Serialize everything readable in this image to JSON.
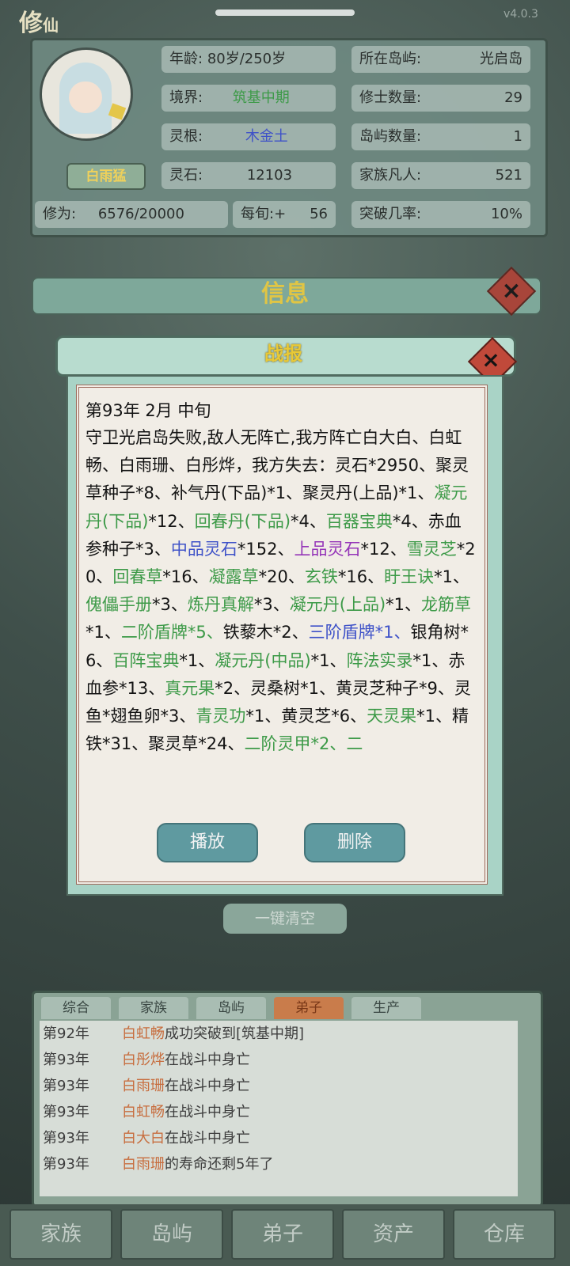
{
  "app": {
    "title_main": "修",
    "title_sub": "仙",
    "version": "v4.0.3"
  },
  "character": {
    "name": "白雨猛",
    "stats_left": [
      {
        "label": "年龄:",
        "value": "80岁/250岁",
        "color": "#2a2f2d"
      },
      {
        "label": "境界:",
        "value": "筑基中期",
        "color": "#3d9a48"
      },
      {
        "label": "灵根:",
        "value": "木金土",
        "color": "#3f52c8"
      },
      {
        "label": "灵石:",
        "value": "12103",
        "color": "#2a2f2d"
      }
    ],
    "stats_right": [
      {
        "label": "所在岛屿:",
        "value": "光启岛"
      },
      {
        "label": "修士数量:",
        "value": "29"
      },
      {
        "label": "岛屿数量:",
        "value": "1"
      },
      {
        "label": "家族凡人:",
        "value": "521"
      }
    ],
    "cultivation": {
      "label": "修为:",
      "value": "6576/20000",
      "per_label": "每旬:+",
      "per_value": "56",
      "break_label": "突破几率:",
      "break_value": "10%"
    }
  },
  "info_panel": {
    "title": "信息",
    "clear_label": "一键清空"
  },
  "report": {
    "title": "战报",
    "date": "第93年  2月  中旬",
    "intro": "守卫光启岛失败,敌人无阵亡,我方阵亡白大白、白虹畅、白雨珊、白彤烨，我方失去：",
    "items": [
      {
        "t": "灵石*2950、",
        "c": "black"
      },
      {
        "t": "聚灵草种子*8、",
        "c": "black"
      },
      {
        "t": "补气丹(下品)*1、",
        "c": "black"
      },
      {
        "t": "聚灵丹(上品)*1、",
        "c": "black"
      },
      {
        "t": "凝元丹(下品)",
        "c": "green"
      },
      {
        "t": "*12、",
        "c": "black"
      },
      {
        "t": "回春丹(下品)",
        "c": "green"
      },
      {
        "t": "*4、",
        "c": "black"
      },
      {
        "t": "百器宝典",
        "c": "green"
      },
      {
        "t": "*4、",
        "c": "black"
      },
      {
        "t": "赤血参种子*3、",
        "c": "black"
      },
      {
        "t": "中品灵石",
        "c": "blue"
      },
      {
        "t": "*152、",
        "c": "black"
      },
      {
        "t": "上品灵石",
        "c": "purple"
      },
      {
        "t": "*12、",
        "c": "black"
      },
      {
        "t": "雪灵芝",
        "c": "green"
      },
      {
        "t": "*20、",
        "c": "black"
      },
      {
        "t": "回春草",
        "c": "green"
      },
      {
        "t": "*16、",
        "c": "black"
      },
      {
        "t": "凝露草",
        "c": "green"
      },
      {
        "t": "*20、",
        "c": "black"
      },
      {
        "t": "玄铁",
        "c": "green"
      },
      {
        "t": "*16、",
        "c": "black"
      },
      {
        "t": "盱王诀",
        "c": "green"
      },
      {
        "t": "*1、",
        "c": "black"
      },
      {
        "t": "傀儡手册",
        "c": "green"
      },
      {
        "t": "*3、",
        "c": "black"
      },
      {
        "t": "炼丹真解",
        "c": "green"
      },
      {
        "t": "*3、",
        "c": "black"
      },
      {
        "t": "凝元丹(上品)",
        "c": "green"
      },
      {
        "t": "*1、",
        "c": "black"
      },
      {
        "t": "龙筋草",
        "c": "green"
      },
      {
        "t": "*1、",
        "c": "black"
      },
      {
        "t": "二阶盾牌*5、",
        "c": "green"
      },
      {
        "t": "铁藜木*2、",
        "c": "black"
      },
      {
        "t": "三阶盾牌*1、",
        "c": "blue"
      },
      {
        "t": "银角树*6、",
        "c": "black"
      },
      {
        "t": "百阵宝典",
        "c": "green"
      },
      {
        "t": "*1、",
        "c": "black"
      },
      {
        "t": "凝元丹(中品)",
        "c": "green"
      },
      {
        "t": "*1、",
        "c": "black"
      },
      {
        "t": "阵法实录",
        "c": "green"
      },
      {
        "t": "*1、",
        "c": "black"
      },
      {
        "t": "赤血参*13、",
        "c": "black"
      },
      {
        "t": "真元果",
        "c": "green"
      },
      {
        "t": "*2、",
        "c": "black"
      },
      {
        "t": "灵桑树*1、",
        "c": "black"
      },
      {
        "t": "黄灵芝种子*9、",
        "c": "black"
      },
      {
        "t": "灵鱼*翅鱼卵*3、",
        "c": "black"
      },
      {
        "t": "青灵功",
        "c": "green"
      },
      {
        "t": "*1、",
        "c": "black"
      },
      {
        "t": "黄灵芝*6、",
        "c": "black"
      },
      {
        "t": "天灵果",
        "c": "green"
      },
      {
        "t": "*1、",
        "c": "black"
      },
      {
        "t": "精铁*31、",
        "c": "black"
      },
      {
        "t": "聚灵草*24、",
        "c": "black"
      },
      {
        "t": "二阶灵甲*2、二",
        "c": "green"
      }
    ],
    "play_label": "播放",
    "delete_label": "删除"
  },
  "log": {
    "tabs": [
      "综合",
      "家族",
      "岛屿",
      "弟子",
      "生产"
    ],
    "active_tab": 3,
    "rows": [
      {
        "year": "第92年",
        "name": "白虹畅",
        "text": "成功突破到[筑基中期]"
      },
      {
        "year": "第93年",
        "name": "白彤烨",
        "text": "在战斗中身亡"
      },
      {
        "year": "第93年",
        "name": "白雨珊",
        "text": "在战斗中身亡"
      },
      {
        "year": "第93年",
        "name": "白虹畅",
        "text": "在战斗中身亡"
      },
      {
        "year": "第93年",
        "name": "白大白",
        "text": "在战斗中身亡"
      },
      {
        "year": "第93年",
        "name": "白雨珊",
        "text": "的寿命还剩5年了"
      }
    ]
  },
  "bottom_nav": [
    "家族",
    "岛屿",
    "弟子",
    "资产",
    "仓库"
  ],
  "colors": {
    "green": "#3d9a48",
    "blue": "#3f52c8",
    "purple": "#9535b8",
    "name_orange": "#c76d3e",
    "gold_title": "#e8c937"
  }
}
